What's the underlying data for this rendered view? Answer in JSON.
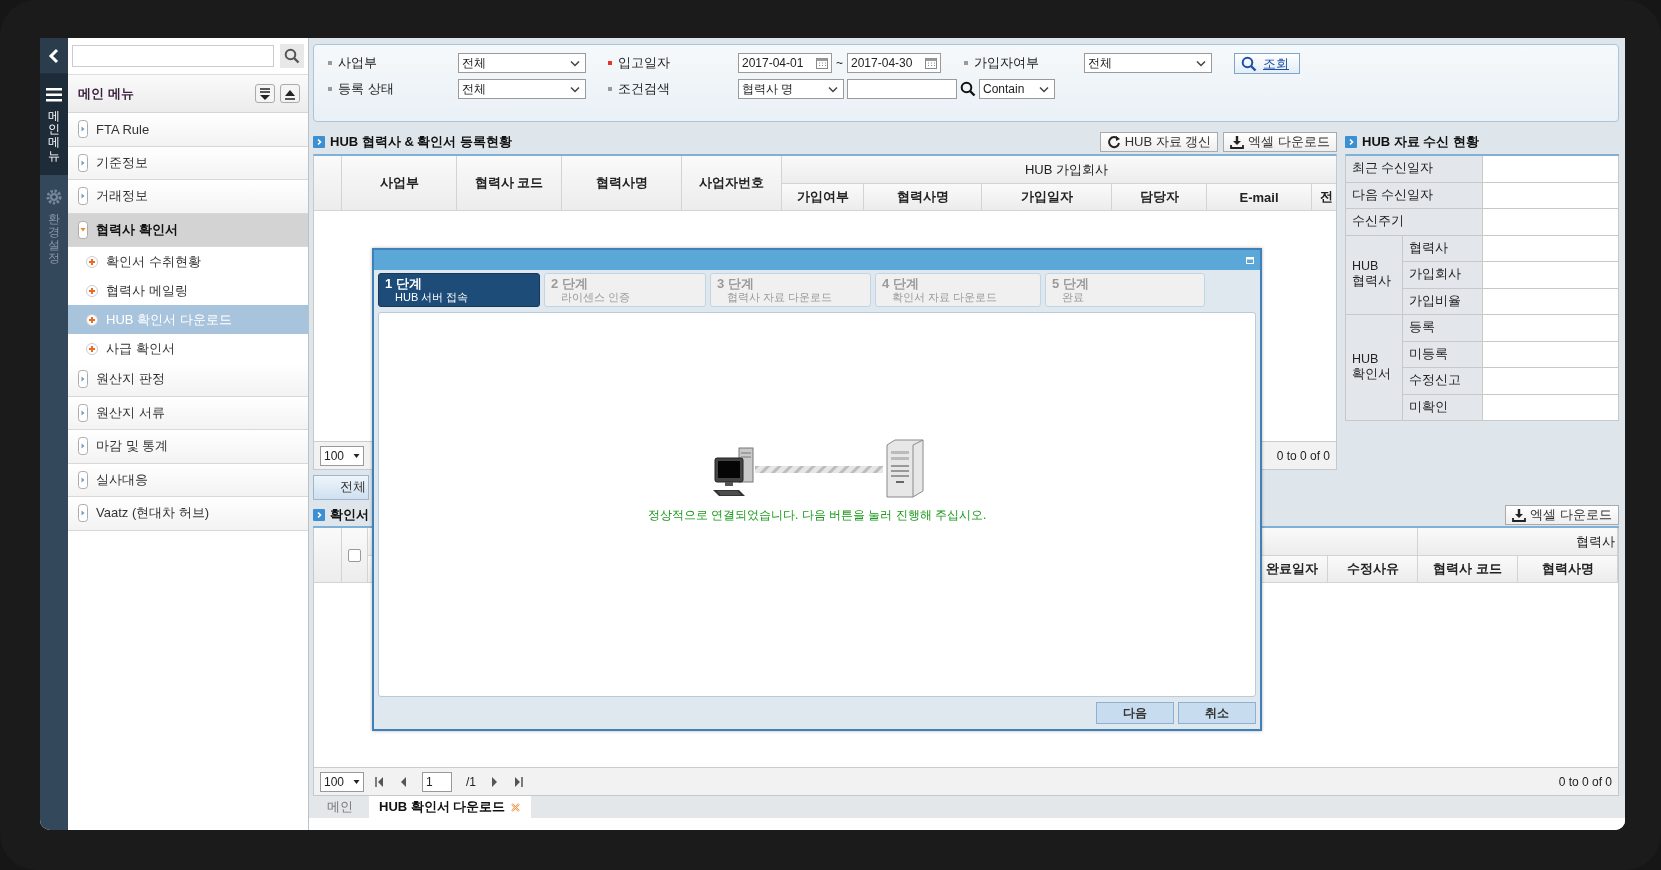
{
  "rail": [
    {
      "label": "메인메뉴",
      "kind": "menu",
      "selected": true
    },
    {
      "label": "환경설정",
      "kind": "settings",
      "selected": false
    }
  ],
  "sidebar": {
    "title": "메인 메뉴",
    "items": [
      {
        "label": "FTA Rule",
        "expanded": false
      },
      {
        "label": "기준정보",
        "expanded": false
      },
      {
        "label": "거래정보",
        "expanded": false
      },
      {
        "label": "협력사 확인서",
        "expanded": true,
        "children": [
          {
            "label": "확인서 수취현황",
            "selected": false
          },
          {
            "label": "협력사 메일링",
            "selected": false
          },
          {
            "label": "HUB 확인서 다운로드",
            "selected": true
          },
          {
            "label": "사급 확인서",
            "selected": false
          }
        ]
      },
      {
        "label": "원산지 판정",
        "expanded": false
      },
      {
        "label": "원산지 서류",
        "expanded": false
      },
      {
        "label": "마감 및 통계",
        "expanded": false
      },
      {
        "label": "실사대응",
        "expanded": false
      },
      {
        "label": "Vaatz (현대차 허브)",
        "expanded": false
      }
    ]
  },
  "filters": [
    {
      "label": "사업부",
      "required": false,
      "kind": "select",
      "value": "전체"
    },
    {
      "label": "입고일자",
      "required": true,
      "kind": "daterange",
      "from": "2017-04-01",
      "separator": "~",
      "to": "2017-04-30"
    },
    {
      "label": "가입자여부",
      "required": false,
      "kind": "select",
      "value": "전체"
    },
    {
      "label": "등록 상태",
      "required": false,
      "kind": "select",
      "value": "전체"
    },
    {
      "label": "조건검색",
      "required": false,
      "kind": "search",
      "field": "협력사 명",
      "mode": "Contain"
    }
  ],
  "search_button": "조회",
  "grid": {
    "title": "HUB 협력사 & 확인서 등록현황",
    "actions": [
      {
        "label": "HUB 자료 갱신",
        "kind": "refresh"
      },
      {
        "label": "엑셀 다운로드",
        "kind": "download"
      }
    ],
    "columns": [
      "사업부",
      "협력사 코드",
      "협력사명",
      "사업자번호"
    ],
    "group": {
      "label": "HUB 가입회사",
      "columns": [
        "가입여부",
        "협력사명",
        "가입일자",
        "담당자",
        "E-mail",
        "전"
      ]
    },
    "pager": {
      "page_size": "100",
      "range": "0 to 0 of 0"
    }
  },
  "status_panel": {
    "title": "HUB 자료 수신 현황",
    "rows": [
      "최근 수신일자",
      "다음 수신일자",
      "수신주기"
    ],
    "groups": [
      {
        "label": "HUB 협력사",
        "items": [
          "협력사",
          "가입회사",
          "가입비율"
        ]
      },
      {
        "label": "HUB 확인서",
        "items": [
          "등록",
          "미등록",
          "수정신고",
          "미확인"
        ]
      }
    ]
  },
  "view_tab": "전체",
  "confirm_grid": {
    "title": "확인서",
    "actions": [
      {
        "label": "엑셀 다운로드",
        "kind": "download"
      }
    ],
    "select_all": {
      "checked": false
    },
    "group": "협력사",
    "columns": [
      "완료일자",
      "수정사유",
      "협력사 코드",
      "협력사명"
    ],
    "pager": {
      "page_size": "100",
      "page": "1",
      "total": "/1",
      "range": "0 to 0 of 0"
    }
  },
  "tabs": [
    {
      "label": "메인",
      "selected": false,
      "closable": false
    },
    {
      "label": "HUB 확인서 다운로드",
      "selected": true,
      "closable": true
    }
  ],
  "dialog": {
    "steps": [
      {
        "label": "1 단계",
        "caption": "HUB 서버 접속",
        "selected": true
      },
      {
        "label": "2 단계",
        "caption": "라이센스 인증",
        "selected": false
      },
      {
        "label": "3 단계",
        "caption": "협력사 자료 다운로드",
        "selected": false
      },
      {
        "label": "4 단계",
        "caption": "확인서 자료 다운로드",
        "selected": false
      },
      {
        "label": "5 단계",
        "caption": "완료",
        "selected": false
      }
    ],
    "message": "정상적으로 연결되었습니다. 다음 버튼을 눌러 진행해 주십시오.",
    "buttons": [
      "다음",
      "취소"
    ]
  }
}
